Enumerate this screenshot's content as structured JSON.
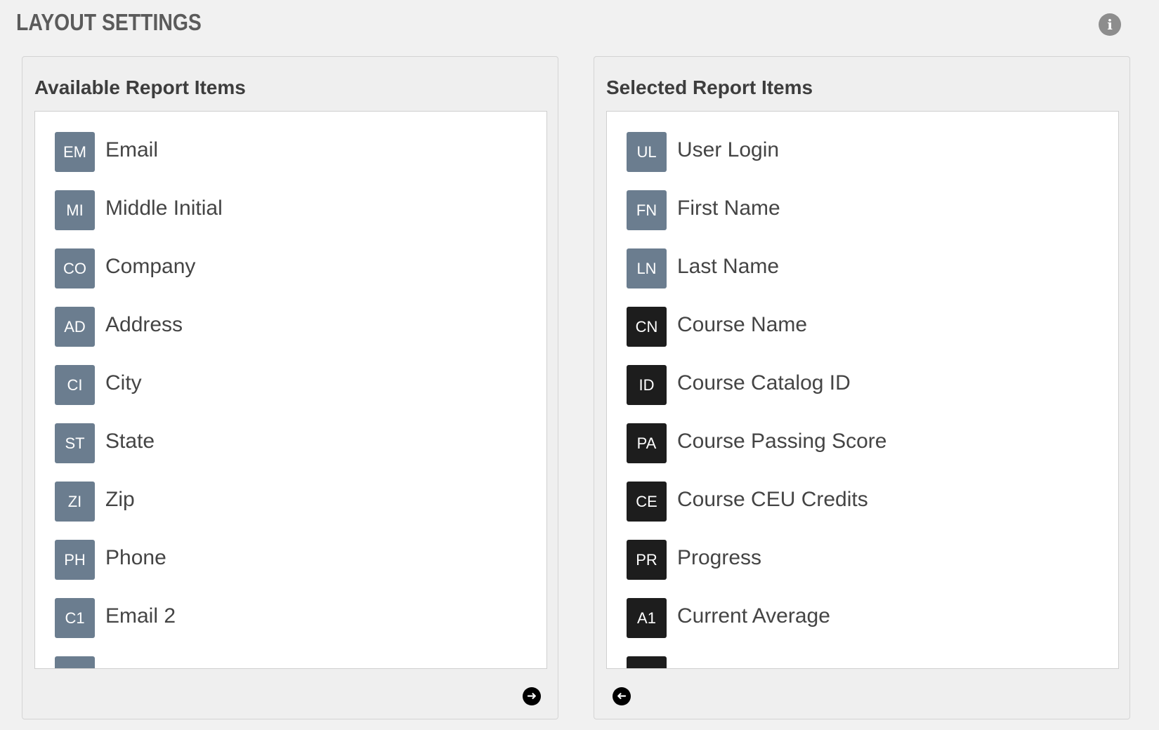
{
  "header": {
    "title": "LAYOUT SETTINGS",
    "info_icon": "info-icon"
  },
  "available": {
    "title": "Available Report Items",
    "badge_color": "#6b7d8f",
    "items": [
      {
        "code": "EM",
        "label": "Email"
      },
      {
        "code": "MI",
        "label": "Middle Initial"
      },
      {
        "code": "CO",
        "label": "Company"
      },
      {
        "code": "AD",
        "label": "Address"
      },
      {
        "code": "CI",
        "label": "City"
      },
      {
        "code": "ST",
        "label": "State"
      },
      {
        "code": "ZI",
        "label": "Zip"
      },
      {
        "code": "PH",
        "label": "Phone"
      },
      {
        "code": "C1",
        "label": "Email 2"
      },
      {
        "code": "",
        "label": ""
      }
    ],
    "move_button_icon": "arrow-right-circle-icon"
  },
  "selected": {
    "title": "Selected Report Items",
    "badge_colors": {
      "profile": "#6b7d8f",
      "course": "#1d1d1d"
    },
    "items": [
      {
        "code": "UL",
        "label": "User Login",
        "kind": "slate"
      },
      {
        "code": "FN",
        "label": "First Name",
        "kind": "slate"
      },
      {
        "code": "LN",
        "label": "Last Name",
        "kind": "slate"
      },
      {
        "code": "CN",
        "label": "Course Name",
        "kind": "dark"
      },
      {
        "code": "ID",
        "label": "Course Catalog ID",
        "kind": "dark"
      },
      {
        "code": "PA",
        "label": "Course Passing Score",
        "kind": "dark"
      },
      {
        "code": "CE",
        "label": "Course CEU Credits",
        "kind": "dark"
      },
      {
        "code": "PR",
        "label": "Progress",
        "kind": "dark"
      },
      {
        "code": "A1",
        "label": "Current Average",
        "kind": "dark"
      },
      {
        "code": "",
        "label": "",
        "kind": "dark"
      }
    ],
    "move_button_icon": "arrow-left-circle-icon"
  }
}
